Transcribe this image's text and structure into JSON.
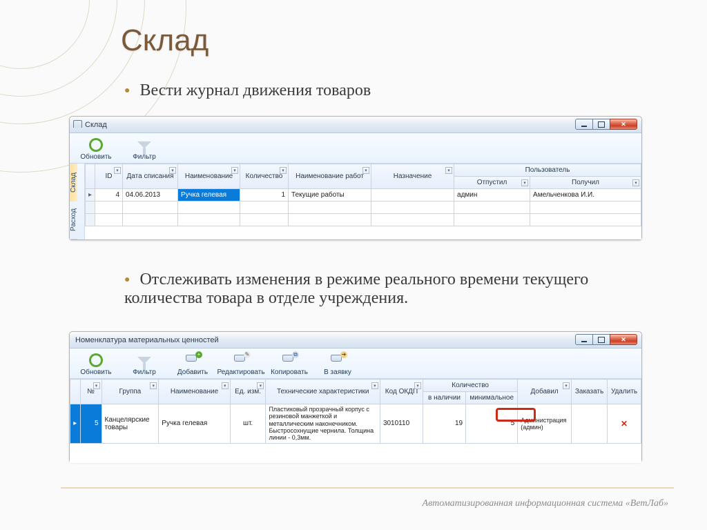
{
  "slide": {
    "title": "Склад",
    "bullet1": "Вести журнал движения товаров",
    "bullet2": "Отслеживать изменения в режиме реального времени текущего количества товара в отделе учреждения.",
    "footer": "Автоматизированная информационная система «ВетЛаб»"
  },
  "win1": {
    "title": "Склад",
    "toolbar": {
      "refresh": "Обновить",
      "filter": "Фильтр"
    },
    "vtabs": {
      "top": "Склад",
      "bottom": "Расход"
    },
    "headers": {
      "id": "ID",
      "date": "Дата списания",
      "name": "Наименование",
      "qty": "Количество",
      "works": "Наименование работ",
      "purpose": "Назначение",
      "user_group": "Пользователь",
      "released": "Отпустил",
      "received": "Получил"
    },
    "row": {
      "id": "4",
      "date": "04.06.2013",
      "name": "Ручка гелевая",
      "qty": "1",
      "works": "Текущие работы",
      "purpose": "",
      "released": "админ",
      "received": "Амельченкова И.И."
    }
  },
  "win2": {
    "title": "Номенклатура материальных ценностей",
    "toolbar": {
      "refresh": "Обновить",
      "filter": "Фильтр",
      "add": "Добавить",
      "edit": "Редактировать",
      "copy": "Копировать",
      "request": "В заявку"
    },
    "headers": {
      "no": "№",
      "group": "Группа",
      "name": "Наименование",
      "unit": "Ед. изм.",
      "tech": "Технические характеристики",
      "okdp": "Код ОКДП",
      "qty_group": "Количество",
      "qty_have": "в наличии",
      "qty_min": "минимальное",
      "added_by": "Добавил",
      "order": "Заказать",
      "delete": "Удалить"
    },
    "row": {
      "no": "5",
      "group": "Канцелярские товары",
      "name": "Ручка гелевая",
      "unit": "шт.",
      "tech": "Пластиковый прозрачный корпус с резиновой манжеткой и металлическим наконечником. Быстросохнущие чернила. Толщина линии - 0,3мм.",
      "okdp": "3010110",
      "qty_have": "19",
      "qty_min": "5",
      "added_by": "Администрация (админ)",
      "order": "",
      "delete": "✕"
    }
  }
}
